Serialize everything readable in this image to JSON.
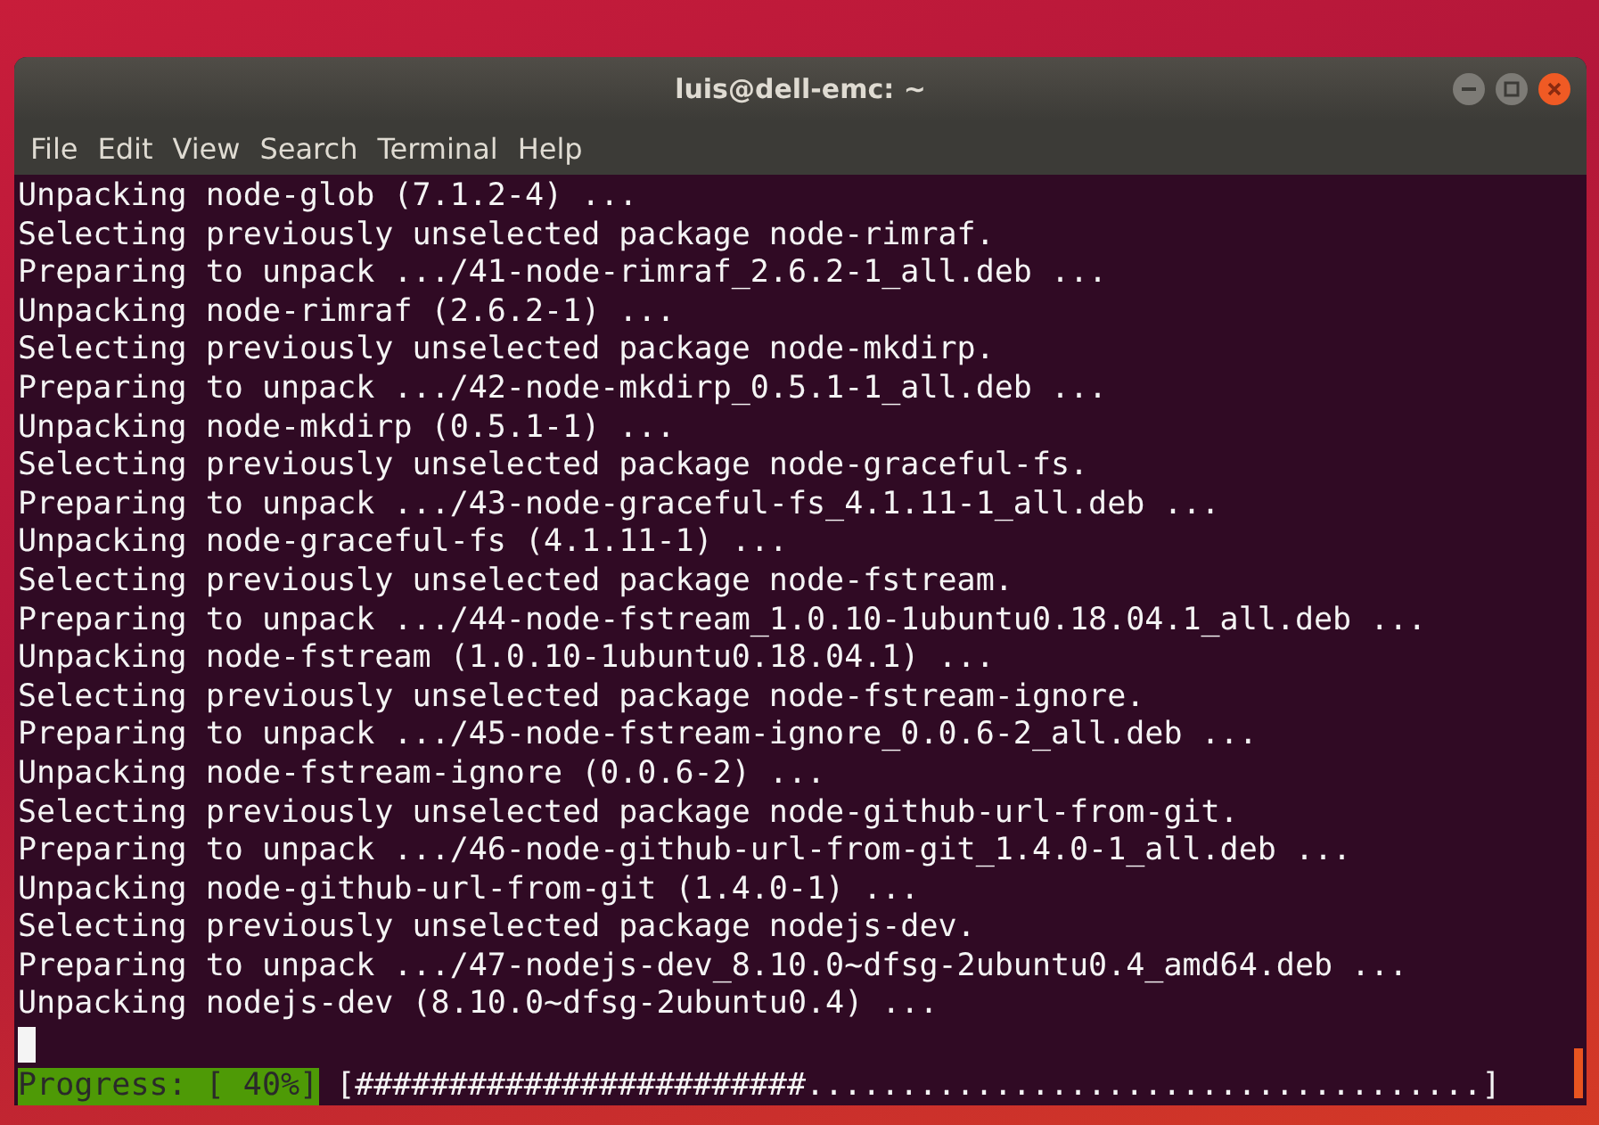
{
  "window": {
    "title": "luis@dell-emc: ~"
  },
  "menu": [
    "File",
    "Edit",
    "View",
    "Search",
    "Terminal",
    "Help"
  ],
  "terminal": {
    "lines": [
      "Unpacking node-glob (7.1.2-4) ...",
      "Selecting previously unselected package node-rimraf.",
      "Preparing to unpack .../41-node-rimraf_2.6.2-1_all.deb ...",
      "Unpacking node-rimraf (2.6.2-1) ...",
      "Selecting previously unselected package node-mkdirp.",
      "Preparing to unpack .../42-node-mkdirp_0.5.1-1_all.deb ...",
      "Unpacking node-mkdirp (0.5.1-1) ...",
      "Selecting previously unselected package node-graceful-fs.",
      "Preparing to unpack .../43-node-graceful-fs_4.1.11-1_all.deb ...",
      "Unpacking node-graceful-fs (4.1.11-1) ...",
      "Selecting previously unselected package node-fstream.",
      "Preparing to unpack .../44-node-fstream_1.0.10-1ubuntu0.18.04.1_all.deb ...",
      "Unpacking node-fstream (1.0.10-1ubuntu0.18.04.1) ...",
      "Selecting previously unselected package node-fstream-ignore.",
      "Preparing to unpack .../45-node-fstream-ignore_0.0.6-2_all.deb ...",
      "Unpacking node-fstream-ignore (0.0.6-2) ...",
      "Selecting previously unselected package node-github-url-from-git.",
      "Preparing to unpack .../46-node-github-url-from-git_1.4.0-1_all.deb ...",
      "Unpacking node-github-url-from-git (1.4.0-1) ...",
      "Selecting previously unselected package nodejs-dev.",
      "Preparing to unpack .../47-nodejs-dev_8.10.0~dfsg-2ubuntu0.4_amd64.deb ...",
      "Unpacking nodejs-dev (8.10.0~dfsg-2ubuntu0.4) ..."
    ],
    "progress": {
      "label": "Progress: [ 40%]",
      "bar": "[########################....................................]"
    }
  }
}
